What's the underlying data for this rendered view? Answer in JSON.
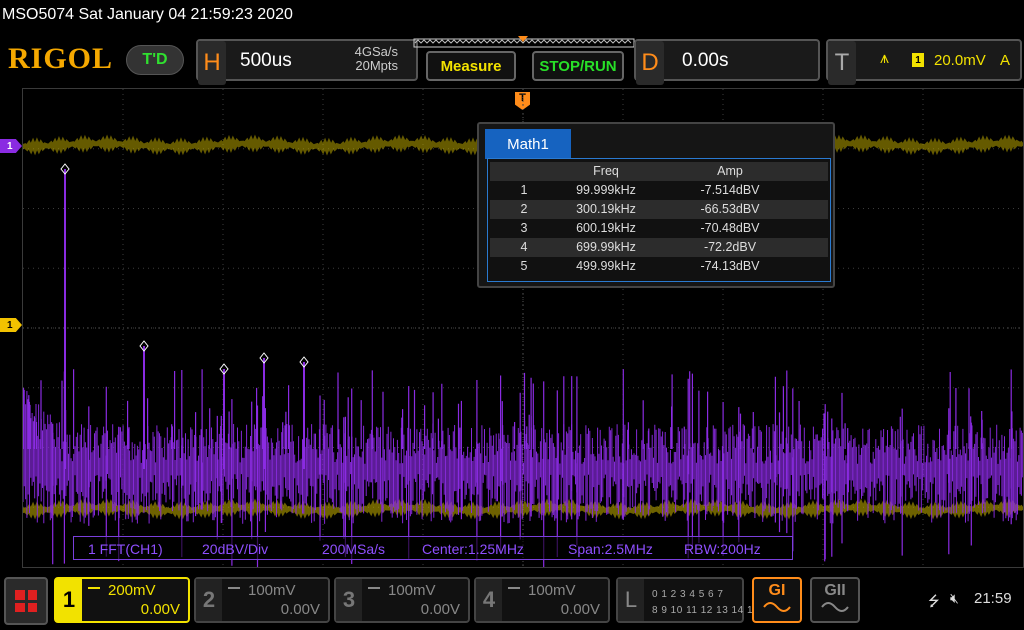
{
  "titlebar": {
    "text": "MSO5074  Sat January 04 21:59:23 2020"
  },
  "topbar": {
    "logo": "RIGOL",
    "td_badge": "T'D",
    "horizontal": {
      "letter": "H",
      "timebase": "500us",
      "sample_rate": "4GSa/s",
      "mem_depth": "20Mpts"
    },
    "measure_label": "Measure",
    "stoprun_label": "STOP/RUN",
    "delay": {
      "letter": "D",
      "value": "0.00s"
    },
    "trigger": {
      "letter": "T",
      "channel": "1",
      "level": "20.0mV",
      "mode": "A"
    }
  },
  "markers": {
    "math": "1",
    "ch1": "1",
    "trigger": "T"
  },
  "math_panel": {
    "tab": "Math1",
    "headers": {
      "freq": "Freq",
      "amp": "Amp"
    },
    "rows": [
      {
        "no": "1",
        "freq": "99.999kHz",
        "amp": "-7.514dBV"
      },
      {
        "no": "2",
        "freq": "300.19kHz",
        "amp": "-66.53dBV"
      },
      {
        "no": "3",
        "freq": "600.19kHz",
        "amp": "-70.48dBV"
      },
      {
        "no": "4",
        "freq": "699.99kHz",
        "amp": "-72.2dBV"
      },
      {
        "no": "5",
        "freq": "499.99kHz",
        "amp": "-74.13dBV"
      }
    ]
  },
  "fft_info": {
    "source": "1 FFT(CH1)",
    "scale": "20dBV/Div",
    "sample_rate": "200MSa/s",
    "center": "Center:1.25MHz",
    "span": "Span:2.5MHz",
    "rbw": "RBW:200Hz"
  },
  "channels": [
    {
      "num": "1",
      "scale": "200mV",
      "offset": "0.00V",
      "active": true
    },
    {
      "num": "2",
      "scale": "100mV",
      "offset": "0.00V",
      "active": false
    },
    {
      "num": "3",
      "scale": "100mV",
      "offset": "0.00V",
      "active": false
    },
    {
      "num": "4",
      "scale": "100mV",
      "offset": "0.00V",
      "active": false
    }
  ],
  "logic": {
    "letter": "L",
    "row1": "0 1 2 3   4 5 6 7",
    "row2": "8 9 10 11  12 13 14 15"
  },
  "generators": {
    "g1": "GI",
    "g2": "GII"
  },
  "status": {
    "usb_icon": "usb-icon",
    "speaker_icon": "speaker-mute-icon",
    "clock": "21:59"
  },
  "colors": {
    "fft_trace": "#8a2be2",
    "ch1": "#f2e200",
    "accent": "#ff8c1a",
    "measure_tab": "#1663c0"
  }
}
